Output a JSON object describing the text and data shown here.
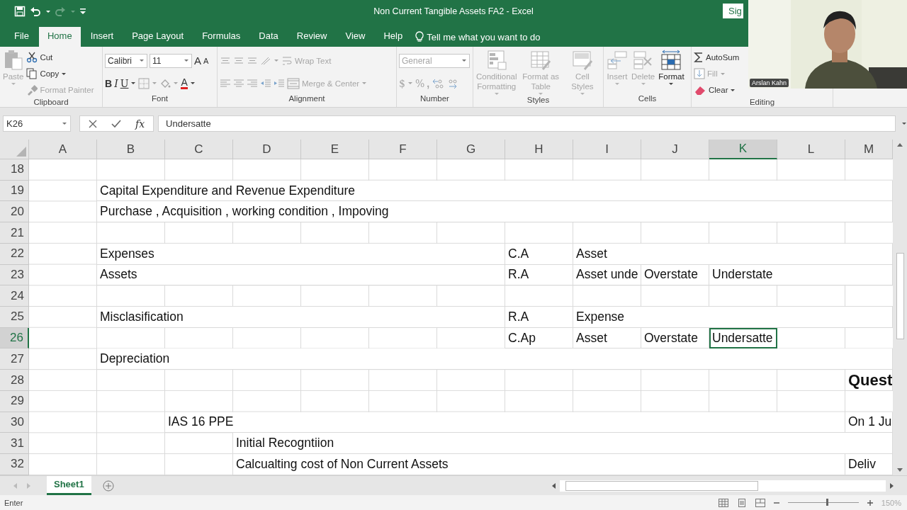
{
  "window": {
    "title": "Non Current Tangible Assets FA2  -  Excel",
    "sign_in": "Sig"
  },
  "quick_access": [
    {
      "kind": "save",
      "disabled": false
    },
    {
      "kind": "undo",
      "disabled": false
    },
    {
      "kind": "redo",
      "disabled": true
    }
  ],
  "tabs": [
    {
      "label": "File",
      "selected": false
    },
    {
      "label": "Home",
      "selected": true
    },
    {
      "label": "Insert",
      "selected": false
    },
    {
      "label": "Page Layout",
      "selected": false
    },
    {
      "label": "Formulas",
      "selected": false
    },
    {
      "label": "Data",
      "selected": false
    },
    {
      "label": "Review",
      "selected": false
    },
    {
      "label": "View",
      "selected": false
    },
    {
      "label": "Help",
      "selected": false
    }
  ],
  "tell_me": "Tell me what you want to do",
  "ribbon": {
    "groups": [
      {
        "label": "Clipboard",
        "large": [
          {
            "kind": "paste",
            "label": "Paste",
            "disabled": true
          }
        ],
        "lines": [
          {
            "items": [
              {
                "kind": "cut",
                "label": "Cut",
                "disabled": false
              }
            ]
          },
          {
            "items": [
              {
                "kind": "copy",
                "label": "Copy",
                "disabled": false
              }
            ]
          },
          {
            "items": [
              {
                "kind": "painter",
                "label": "Format Painter",
                "disabled": true
              }
            ]
          }
        ]
      },
      {
        "label": "Font",
        "lines": [
          {
            "items": [
              {
                "kind": "combo",
                "value": "Calibri",
                "disabled": false
              },
              {
                "kind": "combo",
                "value": "11",
                "disabled": false
              },
              {
                "kind": "grow",
                "label": "A",
                "disabled": false
              },
              {
                "kind": "shrink",
                "label": "A",
                "disabled": false
              }
            ]
          },
          {
            "items": [
              {
                "kind": "bold",
                "label": "B",
                "disabled": false
              },
              {
                "kind": "italic",
                "label": "I",
                "disabled": false
              },
              {
                "kind": "underline",
                "label": "U",
                "disabled": false
              },
              {
                "kind": "borders",
                "disabled": true
              },
              {
                "kind": "fill",
                "disabled": true
              },
              {
                "kind": "fontcolor",
                "label": "A",
                "disabled": false
              }
            ]
          }
        ]
      },
      {
        "label": "Alignment",
        "lines": [
          {
            "items": [
              {
                "kind": "align-top",
                "disabled": true
              },
              {
                "kind": "align-middle",
                "disabled": true
              },
              {
                "kind": "align-bottom",
                "disabled": true
              },
              {
                "kind": "orientation",
                "disabled": true
              },
              {
                "kind": "wrap",
                "label": "Wrap Text",
                "disabled": true
              }
            ]
          },
          {
            "items": [
              {
                "kind": "align-left",
                "disabled": true
              },
              {
                "kind": "align-center",
                "disabled": true
              },
              {
                "kind": "align-right",
                "disabled": true
              },
              {
                "kind": "outdent",
                "disabled": true
              },
              {
                "kind": "indent",
                "disabled": true
              },
              {
                "kind": "merge",
                "label": "Merge & Center",
                "disabled": true
              }
            ]
          }
        ]
      },
      {
        "label": "Number",
        "lines": [
          {
            "items": [
              {
                "kind": "combo",
                "value": "General",
                "disabled": true
              }
            ]
          },
          {
            "items": [
              {
                "kind": "currency",
                "label": "$",
                "disabled": true
              },
              {
                "kind": "percent",
                "label": "%",
                "disabled": true
              },
              {
                "kind": "comma",
                "label": ",",
                "disabled": true
              },
              {
                "kind": "inc-decimal",
                "disabled": true
              },
              {
                "kind": "dec-decimal",
                "disabled": true
              }
            ]
          }
        ]
      },
      {
        "label": "Styles",
        "large": [
          {
            "kind": "conditional",
            "label": "Conditional Formatting",
            "disabled": true
          },
          {
            "kind": "table",
            "label": "Format as Table",
            "disabled": true
          },
          {
            "kind": "styles",
            "label": "Cell Styles",
            "disabled": true
          }
        ]
      },
      {
        "label": "Cells",
        "large": [
          {
            "kind": "insert",
            "label": "Insert",
            "disabled": true
          },
          {
            "kind": "delete",
            "label": "Delete",
            "disabled": true
          },
          {
            "kind": "format",
            "label": "Format",
            "disabled": false
          }
        ]
      },
      {
        "label": "Editing",
        "lines": [
          {
            "items": [
              {
                "kind": "autosum",
                "label": "AutoSum",
                "disabled": false
              }
            ]
          },
          {
            "items": [
              {
                "kind": "fill-down",
                "label": "Fill",
                "disabled": true
              }
            ]
          },
          {
            "items": [
              {
                "kind": "clear",
                "label": "Clear",
                "disabled": false
              }
            ]
          }
        ]
      }
    ]
  },
  "formula_bar": {
    "name_box": "K26",
    "function_label": "fx",
    "value": "Undersatte"
  },
  "sheet": {
    "columns": [
      {
        "label": "A",
        "selected": false
      },
      {
        "label": "B",
        "selected": false
      },
      {
        "label": "C",
        "selected": false
      },
      {
        "label": "D",
        "selected": false
      },
      {
        "label": "E",
        "selected": false
      },
      {
        "label": "F",
        "selected": false
      },
      {
        "label": "G",
        "selected": false
      },
      {
        "label": "H",
        "selected": false
      },
      {
        "label": "I",
        "selected": false
      },
      {
        "label": "J",
        "selected": false
      },
      {
        "label": "K",
        "selected": true
      },
      {
        "label": "L",
        "selected": false
      },
      {
        "label": "M",
        "selected": false
      }
    ],
    "rows": [
      {
        "label": "18",
        "selected": false,
        "cells": [
          null,
          null,
          null,
          null,
          null,
          null,
          null,
          null,
          null,
          null,
          null,
          null,
          null
        ]
      },
      {
        "label": "19",
        "selected": false,
        "cells": [
          null,
          {
            "text": "Capital Expenditure and Revenue Expenditure",
            "selected": false,
            "bold": false
          },
          null,
          null,
          null,
          null,
          null,
          null,
          null,
          null,
          null,
          null,
          null
        ]
      },
      {
        "label": "20",
        "selected": false,
        "cells": [
          null,
          {
            "text": "Purchase , Acquisition , working condition , Impoving",
            "selected": false,
            "bold": false
          },
          null,
          null,
          null,
          null,
          null,
          null,
          null,
          null,
          null,
          null,
          null
        ]
      },
      {
        "label": "21",
        "selected": false,
        "cells": [
          null,
          null,
          null,
          null,
          null,
          null,
          null,
          null,
          null,
          null,
          null,
          null,
          null
        ]
      },
      {
        "label": "22",
        "selected": false,
        "cells": [
          null,
          {
            "text": "Expenses",
            "selected": false,
            "bold": false
          },
          null,
          null,
          null,
          null,
          null,
          {
            "text": "C.A",
            "selected": false,
            "bold": false
          },
          {
            "text": "Asset",
            "selected": false,
            "bold": false
          },
          null,
          null,
          null,
          null
        ]
      },
      {
        "label": "23",
        "selected": false,
        "cells": [
          null,
          {
            "text": "Assets",
            "selected": false,
            "bold": false
          },
          null,
          null,
          null,
          null,
          null,
          {
            "text": "R.A",
            "selected": false,
            "bold": false
          },
          {
            "text": "Asset unde",
            "selected": false,
            "bold": false
          },
          {
            "text": "Overstate",
            "selected": false,
            "bold": false
          },
          {
            "text": "Understate",
            "selected": false,
            "bold": false
          },
          null,
          null
        ]
      },
      {
        "label": "24",
        "selected": false,
        "cells": [
          null,
          null,
          null,
          null,
          null,
          null,
          null,
          null,
          null,
          null,
          null,
          null,
          null
        ]
      },
      {
        "label": "25",
        "selected": false,
        "cells": [
          null,
          {
            "text": "Misclasification",
            "selected": false,
            "bold": false
          },
          null,
          null,
          null,
          null,
          null,
          {
            "text": "R.A",
            "selected": false,
            "bold": false
          },
          {
            "text": "Expense",
            "selected": false,
            "bold": false
          },
          null,
          null,
          null,
          null
        ]
      },
      {
        "label": "26",
        "selected": true,
        "cells": [
          null,
          null,
          null,
          null,
          null,
          null,
          null,
          {
            "text": "C.Ap",
            "selected": false,
            "bold": false
          },
          {
            "text": "Asset",
            "selected": false,
            "bold": false
          },
          {
            "text": "Overstate",
            "selected": false,
            "bold": false
          },
          {
            "text": "Undersatte",
            "selected": true,
            "bold": false
          },
          null,
          null
        ]
      },
      {
        "label": "27",
        "selected": false,
        "cells": [
          null,
          {
            "text": "Depreciation",
            "selected": false,
            "bold": false
          },
          null,
          null,
          null,
          null,
          null,
          null,
          null,
          null,
          null,
          null,
          null
        ]
      },
      {
        "label": "28",
        "selected": false,
        "cells": [
          null,
          null,
          null,
          null,
          null,
          null,
          null,
          null,
          null,
          null,
          null,
          null,
          {
            "text": "Quest",
            "selected": false,
            "bold": true
          }
        ]
      },
      {
        "label": "29",
        "selected": false,
        "cells": [
          null,
          null,
          null,
          null,
          null,
          null,
          null,
          null,
          null,
          null,
          null,
          null,
          null
        ]
      },
      {
        "label": "30",
        "selected": false,
        "cells": [
          null,
          null,
          {
            "text": "IAS 16 PPE",
            "selected": false,
            "bold": false
          },
          null,
          null,
          null,
          null,
          null,
          null,
          null,
          null,
          null,
          {
            "text": "On 1 Ju",
            "selected": false,
            "bold": false
          }
        ]
      },
      {
        "label": "31",
        "selected": false,
        "cells": [
          null,
          null,
          null,
          {
            "text": "Initial Recogntiion",
            "selected": false,
            "bold": false
          },
          null,
          null,
          null,
          null,
          null,
          null,
          null,
          null,
          null
        ]
      },
      {
        "label": "32",
        "selected": false,
        "cells": [
          null,
          null,
          null,
          {
            "text": "Calcualting cost of Non Current Assets",
            "selected": false,
            "bold": false
          },
          null,
          null,
          null,
          null,
          null,
          null,
          null,
          null,
          {
            "text": "Deliv",
            "selected": false,
            "bold": false
          }
        ]
      }
    ]
  },
  "sheet_tabs": [
    {
      "label": "Sheet1",
      "selected": true
    }
  ],
  "status_bar": {
    "mode": "Enter",
    "zoom": {
      "level": 0.55,
      "reading": "150%"
    }
  },
  "webcam": {
    "kind": "picture",
    "name_tag": "Arslan Kahn"
  }
}
